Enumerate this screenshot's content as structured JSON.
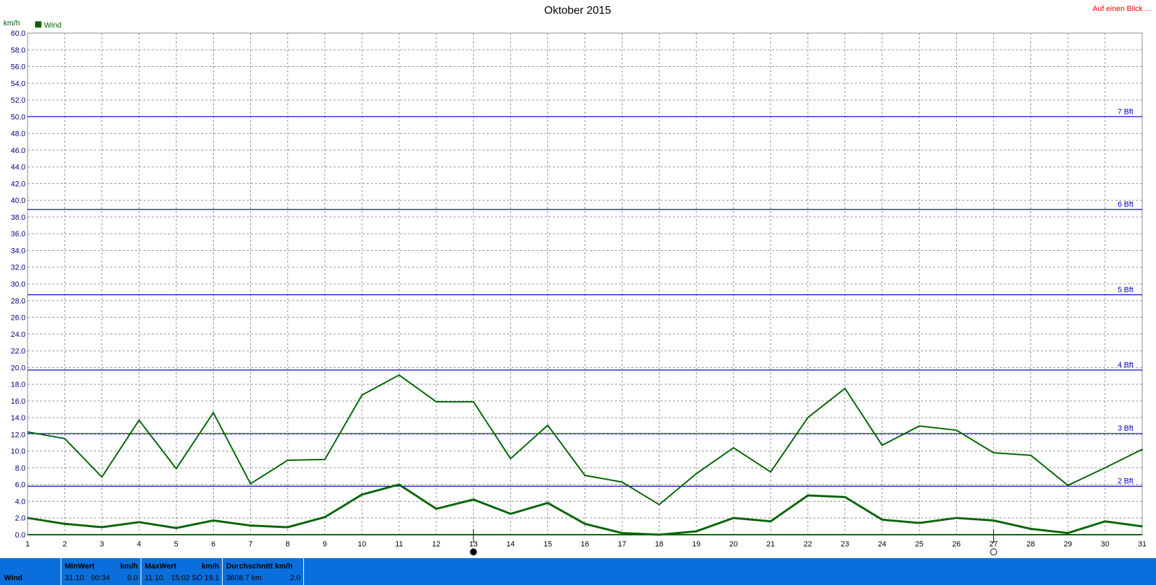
{
  "header": {
    "title": "Oktober 2015",
    "link": "Auf einen Blick ..."
  },
  "legend": {
    "label": "Wind",
    "color": "#006400"
  },
  "colors": {
    "line": "#006400",
    "bft": "#0000cc",
    "grid": "#808080",
    "footer": "#0a6fdc"
  },
  "chart_data": {
    "type": "line",
    "title": "Oktober 2015",
    "ylabel": "km/h",
    "xlabel": "",
    "ylim": [
      0,
      60
    ],
    "yticks": [
      "0.0",
      "2.0",
      "4.0",
      "6.0",
      "8.0",
      "10.0",
      "12.0",
      "14.0",
      "16.0",
      "18.0",
      "20.0",
      "22.0",
      "24.0",
      "26.0",
      "28.0",
      "30.0",
      "32.0",
      "34.0",
      "36.0",
      "38.0",
      "40.0",
      "42.0",
      "44.0",
      "46.0",
      "48.0",
      "50.0",
      "52.0",
      "54.0",
      "56.0",
      "58.0",
      "60.0"
    ],
    "x": [
      "1",
      "2",
      "3",
      "4",
      "5",
      "6",
      "7",
      "8",
      "9",
      "10",
      "11",
      "12",
      "13",
      "14",
      "15",
      "16",
      "17",
      "18",
      "19",
      "20",
      "21",
      "22",
      "23",
      "24",
      "25",
      "26",
      "27",
      "28",
      "29",
      "30",
      "31"
    ],
    "grid": true,
    "legend_position": "top-left",
    "series": [
      {
        "name": "Wind",
        "style": "thin",
        "values": [
          12.3,
          11.5,
          6.9,
          13.7,
          7.9,
          14.6,
          6.1,
          8.9,
          9.0,
          16.7,
          19.1,
          15.9,
          15.9,
          9.1,
          13.1,
          7.1,
          6.3,
          3.6,
          7.3,
          10.4,
          7.5,
          14.0,
          17.5,
          10.7,
          13.0,
          12.5,
          9.8,
          9.5,
          5.9,
          8.0,
          10.2
        ]
      },
      {
        "style": "thick",
        "values": [
          2.0,
          1.3,
          0.9,
          1.5,
          0.8,
          1.7,
          1.1,
          0.9,
          2.1,
          4.8,
          6.0,
          3.1,
          4.2,
          2.5,
          3.8,
          1.3,
          0.2,
          0.0,
          0.4,
          2.0,
          1.6,
          4.7,
          4.5,
          1.8,
          1.4,
          2.0,
          1.7,
          0.7,
          0.2,
          1.6,
          1.0
        ]
      }
    ],
    "bft_lines": [
      {
        "label": "2 Bft",
        "value": 5.8
      },
      {
        "label": "3 Bft",
        "value": 12.1
      },
      {
        "label": "4 Bft",
        "value": 19.7
      },
      {
        "label": "5 Bft",
        "value": 28.7
      },
      {
        "label": "6 Bft",
        "value": 38.9
      },
      {
        "label": "7 Bft",
        "value": 50.0
      }
    ],
    "markers": [
      {
        "x": "13",
        "kind": "moon-full"
      },
      {
        "x": "27",
        "kind": "moon-new"
      }
    ]
  },
  "footer": {
    "row_label": "Wind",
    "min": {
      "header": "MinWert",
      "unit": "km/h",
      "date": "31.10.",
      "time": "00:34",
      "value": "0.0"
    },
    "max": {
      "header": "MaxWert",
      "unit": "km/h",
      "date": "11.10.",
      "time": "15:02",
      "dir": "SO",
      "value": "19.1"
    },
    "avg": {
      "header": "Durchschnitt km/h",
      "distance": "3608.7 km",
      "value": "2.0"
    }
  }
}
